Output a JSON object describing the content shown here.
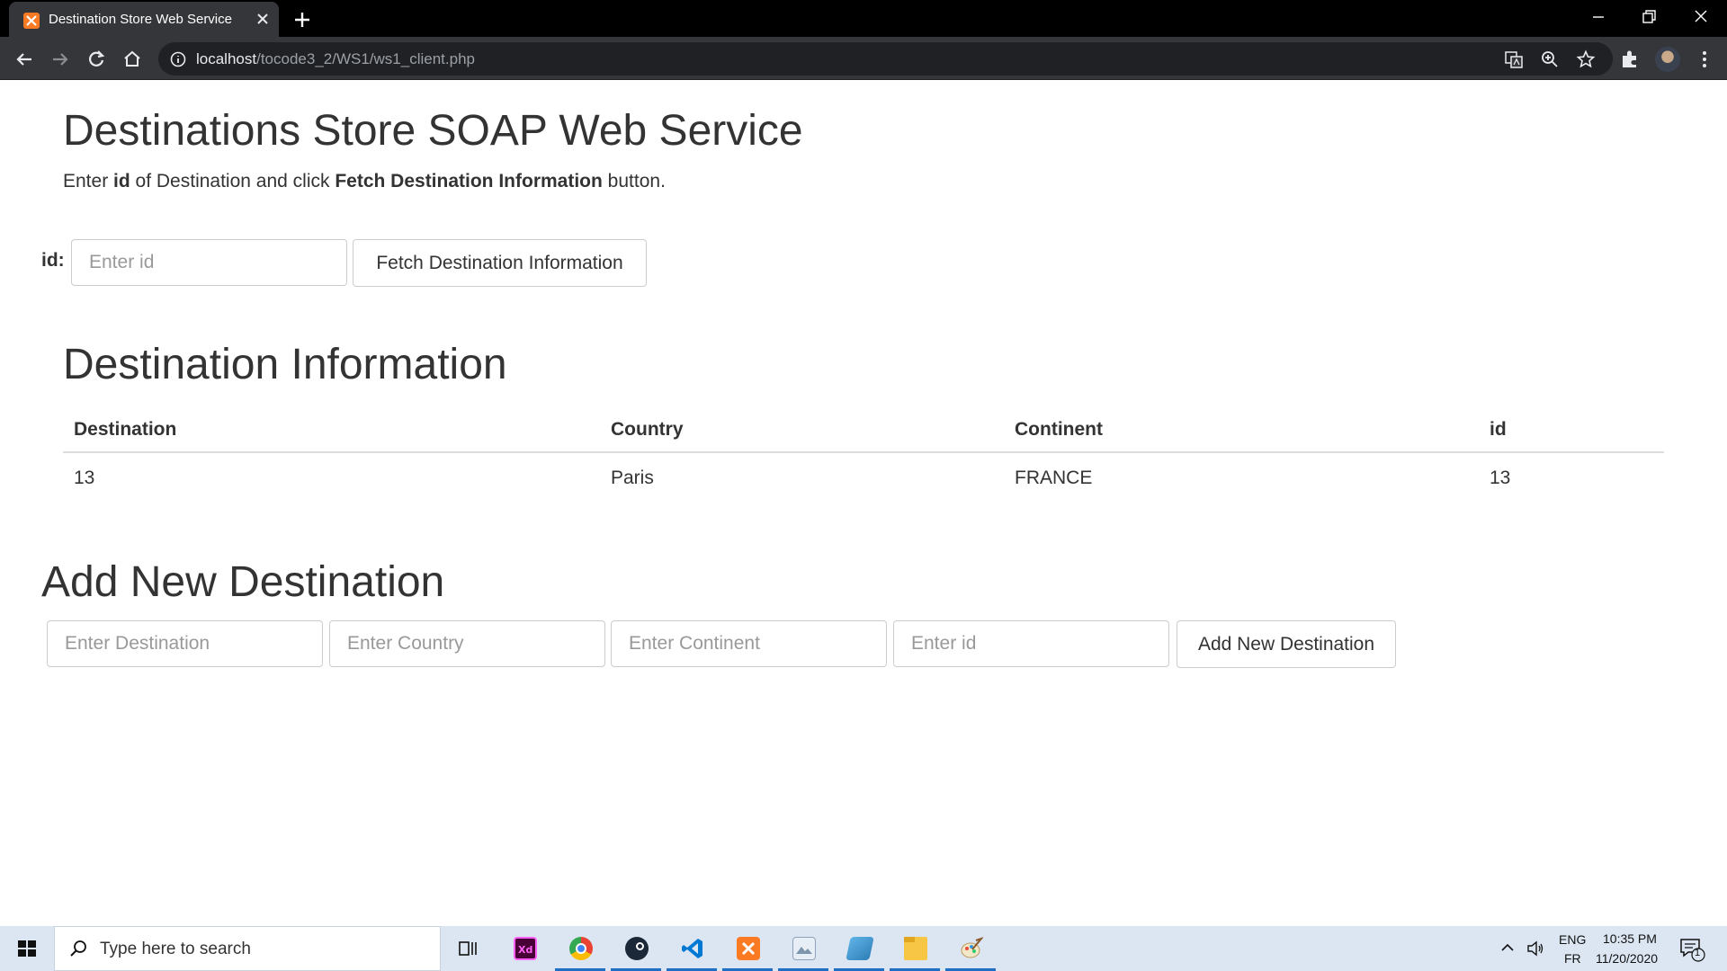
{
  "browser": {
    "tab_title": "Destination Store Web Service",
    "url_host": "localhost",
    "url_path": "/tocode3_2/WS1/ws1_client.php"
  },
  "page": {
    "title": "Destinations Store SOAP Web Service",
    "intro_pre": "Enter ",
    "intro_id": "id",
    "intro_mid": " of Destination and click ",
    "intro_button_name": "Fetch Destination Information",
    "intro_post": " button.",
    "fetch": {
      "id_label": "id:",
      "id_placeholder": "Enter id",
      "id_value": "",
      "button_label": "Fetch Destination Information"
    },
    "info_section": {
      "title": "Destination Information",
      "columns": [
        "Destination",
        "Country",
        "Continent",
        "id"
      ],
      "rows": [
        [
          "13",
          "Paris",
          "FRANCE",
          "13"
        ]
      ]
    },
    "add_section": {
      "title": "Add New Destination",
      "destination_placeholder": "Enter Destination",
      "country_placeholder": "Enter Country",
      "continent_placeholder": "Enter Continent",
      "id_placeholder": "Enter id",
      "button_label": "Add New Destination"
    }
  },
  "taskbar": {
    "search_placeholder": "Type here to search",
    "apps": [
      "task-view",
      "adobe-xd",
      "chrome",
      "steam",
      "vscode",
      "xampp",
      "image-viewer",
      "editor",
      "file-explorer",
      "paint"
    ],
    "lang_top": "ENG",
    "lang_bottom": "FR",
    "time": "10:35 PM",
    "date": "11/20/2020",
    "notification_count": "1"
  },
  "colors": {
    "tab_strip": "#000000",
    "toolbar": "#35363a",
    "omnibox": "#202124",
    "text": "#333333",
    "taskbar": "#dce6f2",
    "accent_running": "#1f6fc4"
  }
}
